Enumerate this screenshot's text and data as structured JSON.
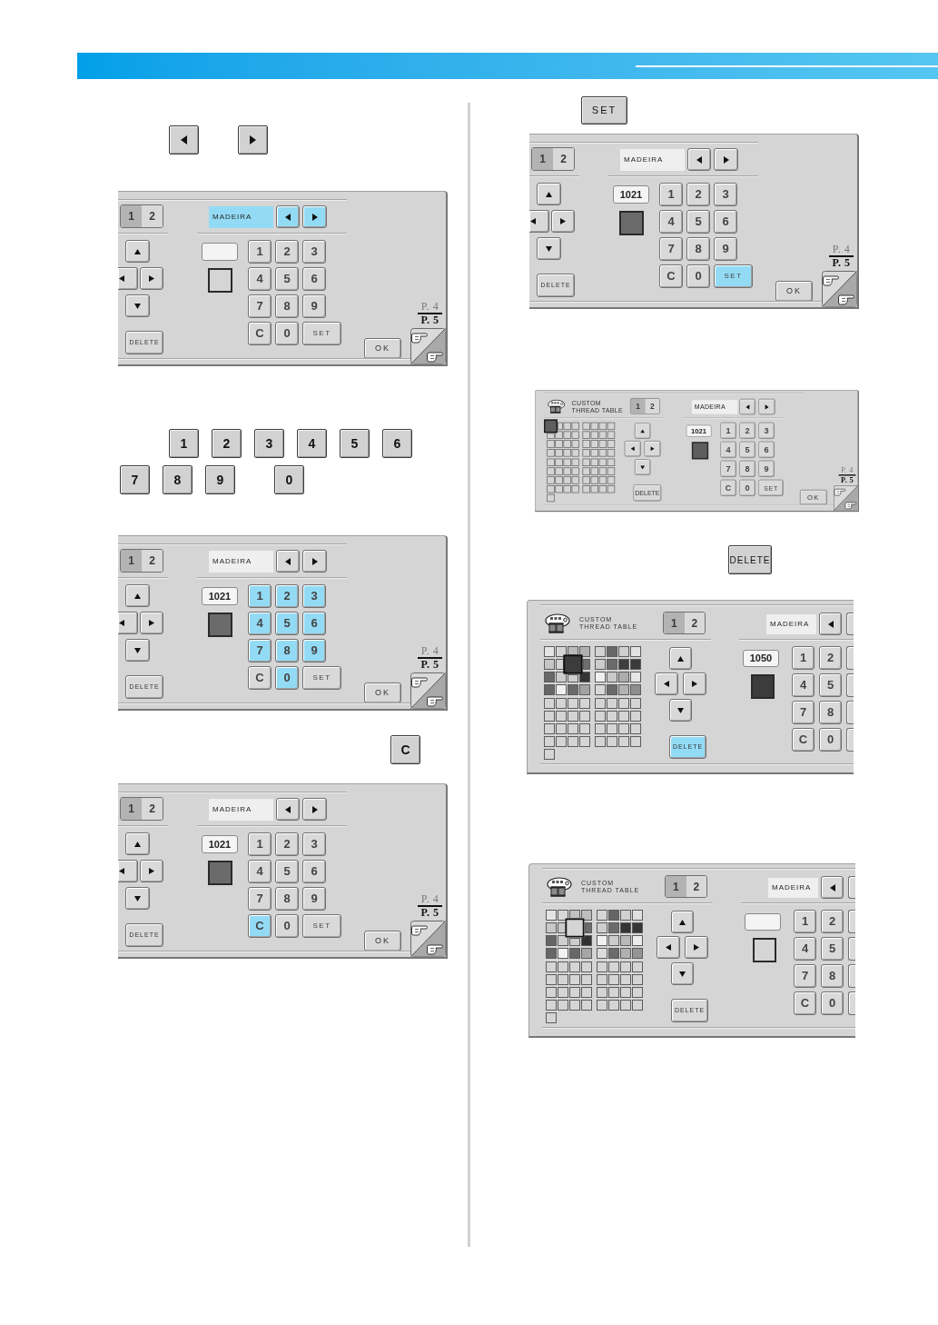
{
  "left_column": [
    {
      "kind": "keys",
      "keys": [
        {
          "kind": "left_arrow"
        },
        {
          "kind": "right_arrow"
        }
      ]
    },
    {
      "kind": "panel",
      "cut_left": true,
      "page_tabs": [
        {
          "label": "1",
          "selected": true
        },
        {
          "label": "2",
          "selected": false
        }
      ],
      "brand": {
        "value": "MADEIRA",
        "pressed": true
      },
      "brand_arrows": [
        {
          "kind": "left",
          "pressed": true
        },
        {
          "kind": "right",
          "pressed": true
        }
      ],
      "delete": {
        "label": "DELETE",
        "pressed": false
      },
      "keypad": [
        [
          {
            "label": "1",
            "pressed": false
          },
          {
            "label": "2",
            "pressed": false
          },
          {
            "label": "3",
            "pressed": false
          }
        ],
        [
          {
            "label": "4",
            "pressed": false
          },
          {
            "label": "5",
            "pressed": false
          },
          {
            "label": "6",
            "pressed": false
          }
        ],
        [
          {
            "label": "7",
            "pressed": false
          },
          {
            "label": "8",
            "pressed": false
          },
          {
            "label": "9",
            "pressed": false
          }
        ],
        [
          {
            "label": "C",
            "pressed": false
          },
          {
            "label": "0",
            "pressed": false
          },
          {
            "label": "SET",
            "pressed": false
          }
        ]
      ],
      "ok": "OK",
      "page_indicator": [
        "P. 4",
        "P. 5"
      ]
    },
    {
      "kind": "keys",
      "keys": [
        {
          "kind": "label",
          "label": "1"
        },
        {
          "kind": "label",
          "label": "2"
        },
        {
          "kind": "label",
          "label": "3"
        },
        {
          "kind": "label",
          "label": "4"
        },
        {
          "kind": "label",
          "label": "5"
        },
        {
          "kind": "label",
          "label": "6"
        }
      ]
    },
    {
      "kind": "keys",
      "keys": [
        {
          "kind": "label",
          "label": "7"
        },
        {
          "kind": "label",
          "label": "8"
        },
        {
          "kind": "label",
          "label": "9"
        },
        {
          "kind": "label",
          "label": "0"
        }
      ]
    },
    {
      "kind": "panel",
      "cut_left": true,
      "page_tabs": [
        {
          "label": "1",
          "selected": true
        },
        {
          "label": "2",
          "selected": false
        }
      ],
      "brand": {
        "value": "MADEIRA",
        "pressed": false
      },
      "brand_arrows": [
        {
          "kind": "left",
          "pressed": false
        },
        {
          "kind": "right",
          "pressed": false
        }
      ],
      "delete": {
        "label": "DELETE",
        "pressed": false
      },
      "code": "1021",
      "swatch": {
        "color": "#6b6b6b"
      },
      "keypad": [
        [
          {
            "label": "1",
            "pressed": true
          },
          {
            "label": "2",
            "pressed": true
          },
          {
            "label": "3",
            "pressed": true
          }
        ],
        [
          {
            "label": "4",
            "pressed": true
          },
          {
            "label": "5",
            "pressed": true
          },
          {
            "label": "6",
            "pressed": true
          }
        ],
        [
          {
            "label": "7",
            "pressed": true
          },
          {
            "label": "8",
            "pressed": true
          },
          {
            "label": "9",
            "pressed": true
          }
        ],
        [
          {
            "label": "C",
            "pressed": false
          },
          {
            "label": "0",
            "pressed": true
          },
          {
            "label": "SET",
            "pressed": false
          }
        ]
      ],
      "ok": "OK",
      "page_indicator": [
        "P. 4",
        "P. 5"
      ]
    },
    {
      "kind": "keys",
      "keys": [
        {
          "kind": "label",
          "label": "C"
        }
      ]
    },
    {
      "kind": "panel",
      "cut_left": true,
      "page_tabs": [
        {
          "label": "1",
          "selected": true
        },
        {
          "label": "2",
          "selected": false
        }
      ],
      "brand": {
        "value": "MADEIRA",
        "pressed": false
      },
      "brand_arrows": [
        {
          "kind": "left",
          "pressed": false
        },
        {
          "kind": "right",
          "pressed": false
        }
      ],
      "delete": {
        "label": "DELETE",
        "pressed": false
      },
      "code": "1021",
      "swatch": {
        "color": "#6b6b6b"
      },
      "keypad": [
        [
          {
            "label": "1",
            "pressed": false
          },
          {
            "label": "2",
            "pressed": false
          },
          {
            "label": "3",
            "pressed": false
          }
        ],
        [
          {
            "label": "4",
            "pressed": false
          },
          {
            "label": "5",
            "pressed": false
          },
          {
            "label": "6",
            "pressed": false
          }
        ],
        [
          {
            "label": "7",
            "pressed": false
          },
          {
            "label": "8",
            "pressed": false
          },
          {
            "label": "9",
            "pressed": false
          }
        ],
        [
          {
            "label": "C",
            "pressed": true
          },
          {
            "label": "0",
            "pressed": false
          },
          {
            "label": "SET",
            "pressed": false
          }
        ]
      ],
      "ok": "OK",
      "page_indicator": [
        "P. 4",
        "P. 5"
      ]
    }
  ],
  "right_column": [
    {
      "kind": "keys",
      "keys": [
        {
          "kind": "label",
          "label": "SET"
        }
      ]
    },
    {
      "kind": "panel",
      "cut_left": true,
      "page_tabs": [
        {
          "label": "1",
          "selected": true
        },
        {
          "label": "2",
          "selected": false
        }
      ],
      "brand": {
        "value": "MADEIRA",
        "pressed": false
      },
      "brand_arrows": [
        {
          "kind": "left",
          "pressed": false
        },
        {
          "kind": "right",
          "pressed": false
        }
      ],
      "delete": {
        "label": "DELETE",
        "pressed": false
      },
      "code": "1021",
      "swatch": {
        "color": "#6b6b6b"
      },
      "keypad": [
        [
          {
            "label": "1",
            "pressed": false
          },
          {
            "label": "2",
            "pressed": false
          },
          {
            "label": "3",
            "pressed": false
          }
        ],
        [
          {
            "label": "4",
            "pressed": false
          },
          {
            "label": "5",
            "pressed": false
          },
          {
            "label": "6",
            "pressed": false
          }
        ],
        [
          {
            "label": "7",
            "pressed": false
          },
          {
            "label": "8",
            "pressed": false
          },
          {
            "label": "9",
            "pressed": false
          }
        ],
        [
          {
            "label": "C",
            "pressed": false
          },
          {
            "label": "0",
            "pressed": false
          },
          {
            "label": "SET",
            "pressed": true
          }
        ]
      ],
      "ok": "OK",
      "page_indicator": [
        "P. 4",
        "P. 5"
      ]
    },
    {
      "kind": "panel",
      "table": {
        "title": "CUSTOM\nTHREAD TABLE",
        "cells": [
          {
            "color": "#5e5e5e",
            "selected": true
          },
          {
            "selected": false
          },
          {
            "selected": false
          },
          {
            "selected": false
          },
          {
            "selected": false
          },
          {
            "selected": false
          },
          {
            "selected": false
          },
          {
            "selected": false
          },
          {
            "selected": false
          },
          {
            "selected": false
          },
          {
            "selected": false
          },
          {
            "selected": false
          },
          {
            "selected": false
          },
          {
            "selected": false
          },
          {
            "selected": false
          },
          {
            "selected": false
          },
          {
            "selected": false
          },
          {
            "selected": false
          },
          {
            "selected": false
          },
          {
            "selected": false
          },
          {
            "selected": false
          },
          {
            "selected": false
          },
          {
            "selected": false
          },
          {
            "selected": false
          },
          {
            "selected": false
          },
          {
            "selected": false
          },
          {
            "selected": false
          },
          {
            "selected": false
          },
          {
            "selected": false
          },
          {
            "selected": false
          },
          {
            "selected": false
          },
          {
            "selected": false
          },
          {
            "selected": false
          },
          {
            "selected": false
          },
          {
            "selected": false
          },
          {
            "selected": false
          },
          {
            "selected": false
          },
          {
            "selected": false
          },
          {
            "selected": false
          },
          {
            "selected": false
          },
          {
            "selected": false
          },
          {
            "selected": false
          },
          {
            "selected": false
          },
          {
            "selected": false
          },
          {
            "selected": false
          },
          {
            "selected": false
          },
          {
            "selected": false
          },
          {
            "selected": false
          },
          {
            "selected": false
          },
          {
            "selected": false
          },
          {
            "selected": false
          },
          {
            "selected": false
          },
          {
            "selected": false
          },
          {
            "selected": false
          },
          {
            "selected": false
          },
          {
            "selected": false
          },
          {
            "selected": false
          },
          {
            "selected": false
          },
          {
            "selected": false
          },
          {
            "selected": false
          },
          {
            "selected": false
          },
          {
            "selected": false
          },
          {
            "selected": false
          },
          {
            "selected": false
          },
          {
            "selected": false
          }
        ]
      },
      "page_tabs": [
        {
          "label": "1",
          "selected": true
        },
        {
          "label": "2",
          "selected": false
        }
      ],
      "brand": {
        "value": "MADEIRA",
        "pressed": false
      },
      "brand_arrows": [
        {
          "kind": "left",
          "pressed": false
        },
        {
          "kind": "right",
          "pressed": false
        }
      ],
      "delete": {
        "label": "DELETE",
        "pressed": false
      },
      "code": "1021",
      "swatch": {
        "color": "#5e5e5e"
      },
      "keypad": [
        [
          {
            "label": "1",
            "pressed": false
          },
          {
            "label": "2",
            "pressed": false
          },
          {
            "label": "3",
            "pressed": false
          }
        ],
        [
          {
            "label": "4",
            "pressed": false
          },
          {
            "label": "5",
            "pressed": false
          },
          {
            "label": "6",
            "pressed": false
          }
        ],
        [
          {
            "label": "7",
            "pressed": false
          },
          {
            "label": "8",
            "pressed": false
          },
          {
            "label": "9",
            "pressed": false
          }
        ],
        [
          {
            "label": "C",
            "pressed": false
          },
          {
            "label": "0",
            "pressed": false
          },
          {
            "label": "SET",
            "pressed": false
          }
        ]
      ],
      "ok": "OK",
      "page_indicator": [
        "P. 4",
        "P. 5"
      ]
    },
    {
      "kind": "keys",
      "keys": [
        {
          "kind": "label",
          "label": "DELETE"
        }
      ]
    },
    {
      "kind": "panel",
      "cut_right": true,
      "table": {
        "title": "CUSTOM\nTHREAD TABLE",
        "cells": [
          {
            "color": "#e4e4e4",
            "selected": false
          },
          {
            "color": "#d6d6d6",
            "selected": false
          },
          {
            "color": "#b9b9b9",
            "selected": false
          },
          {
            "color": "#b0b0b0",
            "selected": false
          },
          {
            "color": "#d2d2d2",
            "selected": false
          },
          {
            "color": "#676767",
            "selected": false
          },
          {
            "color": "#cfcfcf",
            "selected": false
          },
          {
            "color": "#e2e2e2",
            "selected": false
          },
          {
            "color": "#c6c6c6",
            "selected": false
          },
          {
            "color": "#d4d4d4",
            "selected": false
          },
          {
            "color": "#3c3c3c",
            "selected": true
          },
          {
            "color": "#6e6e6e",
            "selected": false
          },
          {
            "color": "#cccccc",
            "selected": false
          },
          {
            "color": "#6a6a6a",
            "selected": false
          },
          {
            "color": "#3e3e3e",
            "selected": false
          },
          {
            "color": "#3a3a3a",
            "selected": false
          },
          {
            "color": "#686868",
            "selected": false
          },
          {
            "color": "#cdcdcd",
            "selected": false
          },
          {
            "color": "#cdcdcd",
            "selected": false
          },
          {
            "color": "#353535",
            "selected": false
          },
          {
            "color": "#efefef",
            "selected": false
          },
          {
            "color": "#c9c9c9",
            "selected": false
          },
          {
            "color": "#adadad",
            "selected": false
          },
          {
            "color": "#e6e6e6",
            "selected": false
          },
          {
            "color": "#666666",
            "selected": false
          },
          {
            "color": "#efefef",
            "selected": false
          },
          {
            "color": "#696969",
            "selected": false
          },
          {
            "color": "#a2a2a2",
            "selected": false
          },
          {
            "color": "#d9d9d9",
            "selected": false
          },
          {
            "color": "#6a6a6a",
            "selected": false
          },
          {
            "color": "#b2b2b2",
            "selected": false
          },
          {
            "color": "#8e8e8e",
            "selected": false
          },
          {
            "selected": false
          },
          {
            "selected": false
          },
          {
            "selected": false
          },
          {
            "selected": false
          },
          {
            "selected": false
          },
          {
            "selected": false
          },
          {
            "selected": false
          },
          {
            "selected": false
          },
          {
            "selected": false
          },
          {
            "selected": false
          },
          {
            "selected": false
          },
          {
            "selected": false
          },
          {
            "selected": false
          },
          {
            "selected": false
          },
          {
            "selected": false
          },
          {
            "selected": false
          },
          {
            "selected": false
          },
          {
            "selected": false
          },
          {
            "selected": false
          },
          {
            "selected": false
          },
          {
            "selected": false
          },
          {
            "selected": false
          },
          {
            "selected": false
          },
          {
            "selected": false
          },
          {
            "selected": false
          },
          {
            "selected": false
          },
          {
            "selected": false
          },
          {
            "selected": false
          },
          {
            "selected": false
          },
          {
            "selected": false
          },
          {
            "selected": false
          },
          {
            "selected": false
          },
          {
            "selected": false
          }
        ]
      },
      "page_tabs": [
        {
          "label": "1",
          "selected": true
        },
        {
          "label": "2",
          "selected": false
        }
      ],
      "brand": {
        "value": "MADEIRA",
        "pressed": false
      },
      "brand_arrows": [
        {
          "kind": "left",
          "pressed": false
        }
      ],
      "delete": {
        "label": "DELETE",
        "pressed": true
      },
      "code": "1050",
      "swatch": {
        "color": "#3c3c3c"
      },
      "keypad": [
        [
          {
            "label": "1",
            "pressed": false
          },
          {
            "label": "2",
            "pressed": false
          }
        ],
        [
          {
            "label": "4",
            "pressed": false
          },
          {
            "label": "5",
            "pressed": false
          }
        ],
        [
          {
            "label": "7",
            "pressed": false
          },
          {
            "label": "8",
            "pressed": false
          }
        ],
        [
          {
            "label": "C",
            "pressed": false
          },
          {
            "label": "0",
            "pressed": false
          }
        ]
      ]
    },
    {
      "kind": "panel",
      "cut_right": true,
      "table": {
        "title": "CUSTOM\nTHREAD TABLE",
        "cells": [
          {
            "color": "#e4e4e4",
            "selected": false
          },
          {
            "color": "#d8d8d8",
            "selected": false
          },
          {
            "color": "#c0c0c0",
            "selected": false
          },
          {
            "color": "#bdbdbd",
            "selected": false
          },
          {
            "color": "#d6d6d6",
            "selected": false
          },
          {
            "color": "#656565",
            "selected": false
          },
          {
            "color": "#d0d0d0",
            "selected": false
          },
          {
            "color": "#e0e0e0",
            "selected": false
          },
          {
            "color": "#c8c8c8",
            "selected": false
          },
          {
            "color": "#cccccc",
            "selected": false
          },
          {
            "selected": true
          },
          {
            "color": "#6c6c6c",
            "selected": false
          },
          {
            "color": "#cfcfcf",
            "selected": false
          },
          {
            "color": "#6c6c6c",
            "selected": false
          },
          {
            "color": "#333333",
            "selected": false
          },
          {
            "color": "#353535",
            "selected": false
          },
          {
            "color": "#656565",
            "selected": false
          },
          {
            "color": "#cfcfcf",
            "selected": false
          },
          {
            "color": "#cdcdcd",
            "selected": false
          },
          {
            "color": "#313131",
            "selected": false
          },
          {
            "color": "#f0f0f0",
            "selected": false
          },
          {
            "color": "#cccccc",
            "selected": false
          },
          {
            "color": "#b8b8b8",
            "selected": false
          },
          {
            "color": "#ececec",
            "selected": false
          },
          {
            "color": "#666666",
            "selected": false
          },
          {
            "color": "#f2f2f2",
            "selected": false
          },
          {
            "color": "#686868",
            "selected": false
          },
          {
            "color": "#a6a6a6",
            "selected": false
          },
          {
            "color": "#dcdcdc",
            "selected": false
          },
          {
            "color": "#6b6b6b",
            "selected": false
          },
          {
            "color": "#b0b0b0",
            "selected": false
          },
          {
            "color": "#959595",
            "selected": false
          },
          {
            "selected": false
          },
          {
            "selected": false
          },
          {
            "selected": false
          },
          {
            "selected": false
          },
          {
            "selected": false
          },
          {
            "selected": false
          },
          {
            "selected": false
          },
          {
            "selected": false
          },
          {
            "selected": false
          },
          {
            "selected": false
          },
          {
            "selected": false
          },
          {
            "selected": false
          },
          {
            "selected": false
          },
          {
            "selected": false
          },
          {
            "selected": false
          },
          {
            "selected": false
          },
          {
            "selected": false
          },
          {
            "selected": false
          },
          {
            "selected": false
          },
          {
            "selected": false
          },
          {
            "selected": false
          },
          {
            "selected": false
          },
          {
            "selected": false
          },
          {
            "selected": false
          },
          {
            "selected": false
          },
          {
            "selected": false
          },
          {
            "selected": false
          },
          {
            "selected": false
          },
          {
            "selected": false
          },
          {
            "selected": false
          },
          {
            "selected": false
          },
          {
            "selected": false
          },
          {
            "selected": false
          }
        ]
      },
      "page_tabs": [
        {
          "label": "1",
          "selected": true
        },
        {
          "label": "2",
          "selected": false
        }
      ],
      "brand": {
        "value": "MADEIRA",
        "pressed": false
      },
      "brand_arrows": [
        {
          "kind": "left",
          "pressed": false
        }
      ],
      "delete": {
        "label": "DELETE",
        "pressed": false
      },
      "keypad": [
        [
          {
            "label": "1",
            "pressed": false
          },
          {
            "label": "2",
            "pressed": false
          }
        ],
        [
          {
            "label": "4",
            "pressed": false
          },
          {
            "label": "5",
            "pressed": false
          }
        ],
        [
          {
            "label": "7",
            "pressed": false
          },
          {
            "label": "8",
            "pressed": false
          }
        ],
        [
          {
            "label": "C",
            "pressed": false
          },
          {
            "label": "0",
            "pressed": false
          }
        ]
      ]
    }
  ]
}
